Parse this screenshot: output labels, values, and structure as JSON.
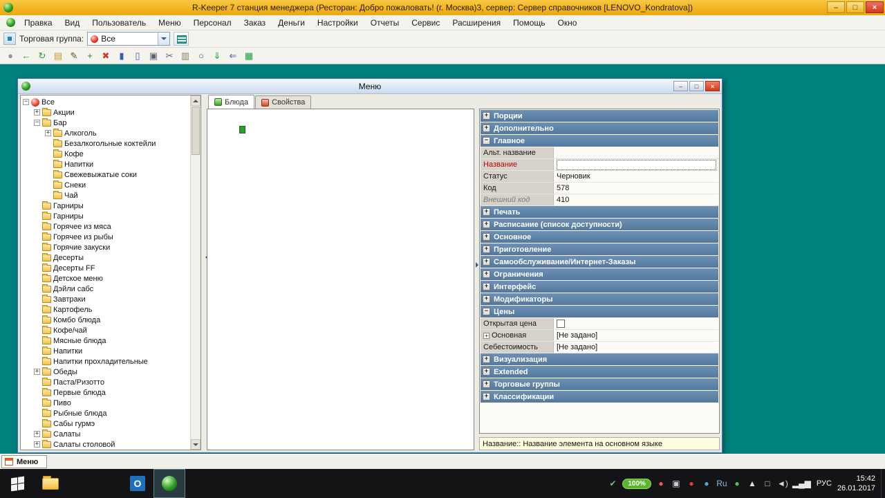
{
  "colors": {
    "titlebar_orange": "#f2b01c",
    "desktop_teal": "#00807e",
    "section_header_blue": "#5d81a6",
    "hint_yellow": "#ffffe0",
    "required_label_red": "#c00000",
    "battery_green": "#5cb52c"
  },
  "app": {
    "title": "R-Keeper 7 станция менеджера (Ресторан: Добро пожаловать! (г. Москва)3, сервер: Сервер справочников [LENOVO_Kondratova])"
  },
  "window_controls": {
    "minimize": "–",
    "maximize": "□",
    "close": "×"
  },
  "menubar": {
    "items": [
      "Правка",
      "Вид",
      "Пользователь",
      "Меню",
      "Персонал",
      "Заказ",
      "Деньги",
      "Настройки",
      "Отчеты",
      "Сервис",
      "Расширения",
      "Помощь",
      "Окно"
    ]
  },
  "trade_toolbar": {
    "label": "Торговая группа:",
    "value": "Все"
  },
  "toolbar_icons": [
    {
      "name": "properties-icon",
      "glyph": "●",
      "color": "#8f97a0"
    },
    {
      "name": "back-icon",
      "glyph": "←",
      "color": "#1f9e40"
    },
    {
      "name": "refresh-icon",
      "glyph": "↻",
      "color": "#1f9e40"
    },
    {
      "name": "open-folder-icon",
      "glyph": "▤",
      "color": "#c79b23"
    },
    {
      "name": "edit-icon",
      "glyph": "✎",
      "color": "#6b4f1d"
    },
    {
      "name": "new-item-icon",
      "glyph": "+",
      "color": "#2d7d2d"
    },
    {
      "name": "delete-icon",
      "glyph": "✖",
      "color": "#cf3a22"
    },
    {
      "name": "save-icon",
      "glyph": "▮",
      "color": "#3a5fa8"
    },
    {
      "name": "save-all-icon",
      "glyph": "▯",
      "color": "#3a5fa8"
    },
    {
      "name": "copy-icon",
      "glyph": "▣",
      "color": "#5b6770"
    },
    {
      "name": "cut-icon",
      "glyph": "✂",
      "color": "#5b6770"
    },
    {
      "name": "paste-icon",
      "glyph": "▥",
      "color": "#8a7d5b"
    },
    {
      "name": "search-icon",
      "glyph": "○",
      "color": "#2d5d8d"
    },
    {
      "name": "export-icon",
      "glyph": "⇓",
      "color": "#1f9e40"
    },
    {
      "name": "import-icon",
      "glyph": "⇐",
      "color": "#3a5fa8"
    },
    {
      "name": "table-view-icon",
      "glyph": "▦",
      "color": "#1f9e40"
    }
  ],
  "menu_window": {
    "title": "Меню",
    "tabs": [
      {
        "id": "dishes",
        "label": "Блюда",
        "active": true,
        "icon": "dishes-tab-icon"
      },
      {
        "id": "properties",
        "label": "Свойства",
        "active": false,
        "icon": "properties-tab-icon"
      }
    ],
    "tree": [
      {
        "label": "Все",
        "depth": 0,
        "expander": "minus",
        "icon": "root"
      },
      {
        "label": "Акции",
        "depth": 1,
        "expander": "plus",
        "icon": "folder"
      },
      {
        "label": "Бар",
        "depth": 1,
        "expander": "minus",
        "icon": "folder"
      },
      {
        "label": "Алкоголь",
        "depth": 2,
        "expander": "plus",
        "icon": "folder"
      },
      {
        "label": "Безалкогольные коктейли",
        "depth": 2,
        "expander": "none",
        "icon": "folder"
      },
      {
        "label": "Кофе",
        "depth": 2,
        "expander": "none",
        "icon": "folder"
      },
      {
        "label": "Напитки",
        "depth": 2,
        "expander": "none",
        "icon": "folder"
      },
      {
        "label": "Свежевыжатые соки",
        "depth": 2,
        "expander": "none",
        "icon": "folder"
      },
      {
        "label": "Снеки",
        "depth": 2,
        "expander": "none",
        "icon": "folder"
      },
      {
        "label": "Чай",
        "depth": 2,
        "expander": "none",
        "icon": "folder"
      },
      {
        "label": "Гарниры",
        "depth": 1,
        "expander": "none",
        "icon": "folder"
      },
      {
        "label": "Гарниры",
        "depth": 1,
        "expander": "none",
        "icon": "folder"
      },
      {
        "label": "Горячее из мяса",
        "depth": 1,
        "expander": "none",
        "icon": "folder"
      },
      {
        "label": "Горячее из рыбы",
        "depth": 1,
        "expander": "none",
        "icon": "folder"
      },
      {
        "label": "Горячие закуски",
        "depth": 1,
        "expander": "none",
        "icon": "folder"
      },
      {
        "label": "Десерты",
        "depth": 1,
        "expander": "none",
        "icon": "folder"
      },
      {
        "label": "Десерты FF",
        "depth": 1,
        "expander": "none",
        "icon": "folder"
      },
      {
        "label": "Детское меню",
        "depth": 1,
        "expander": "none",
        "icon": "folder"
      },
      {
        "label": "Дэйли сабс",
        "depth": 1,
        "expander": "none",
        "icon": "folder"
      },
      {
        "label": "Завтраки",
        "depth": 1,
        "expander": "none",
        "icon": "folder"
      },
      {
        "label": "Картофель",
        "depth": 1,
        "expander": "none",
        "icon": "folder"
      },
      {
        "label": "Комбо блюда",
        "depth": 1,
        "expander": "none",
        "icon": "folder"
      },
      {
        "label": "Кофе/чай",
        "depth": 1,
        "expander": "none",
        "icon": "folder"
      },
      {
        "label": "Мясные блюда",
        "depth": 1,
        "expander": "none",
        "icon": "folder"
      },
      {
        "label": "Напитки",
        "depth": 1,
        "expander": "none",
        "icon": "folder"
      },
      {
        "label": "Напитки прохладительные",
        "depth": 1,
        "expander": "none",
        "icon": "folder"
      },
      {
        "label": "Обеды",
        "depth": 1,
        "expander": "plus",
        "icon": "folder"
      },
      {
        "label": "Паста/Ризотто",
        "depth": 1,
        "expander": "none",
        "icon": "folder"
      },
      {
        "label": "Первые блюда",
        "depth": 1,
        "expander": "none",
        "icon": "folder"
      },
      {
        "label": "Пиво",
        "depth": 1,
        "expander": "none",
        "icon": "folder"
      },
      {
        "label": "Рыбные блюда",
        "depth": 1,
        "expander": "none",
        "icon": "folder"
      },
      {
        "label": "Сабы гурмэ",
        "depth": 1,
        "expander": "none",
        "icon": "folder"
      },
      {
        "label": "Салаты",
        "depth": 1,
        "expander": "plus",
        "icon": "folder"
      },
      {
        "label": "Салаты столовой",
        "depth": 1,
        "expander": "plus",
        "icon": "folder"
      }
    ],
    "sections": [
      {
        "label": "Порции",
        "expanded": false
      },
      {
        "label": "Дополнительно",
        "expanded": false
      },
      {
        "label": "Главное",
        "expanded": true,
        "rows": [
          {
            "label": "Альт. название",
            "value": "",
            "kind": "text"
          },
          {
            "label": "Название",
            "value": "",
            "kind": "input",
            "label_style": "red"
          },
          {
            "label": "Статус",
            "value": "Черновик",
            "kind": "text"
          },
          {
            "label": "Код",
            "value": "578",
            "kind": "text"
          },
          {
            "label": "Внешний код",
            "value": "410",
            "kind": "text",
            "label_style": "italic"
          }
        ]
      },
      {
        "label": "Печать",
        "expanded": false
      },
      {
        "label": "Расписание (список доступности)",
        "expanded": false
      },
      {
        "label": "Основное",
        "expanded": false
      },
      {
        "label": "Приготовление",
        "expanded": false
      },
      {
        "label": "Самообслуживание/Интернет-Заказы",
        "expanded": false
      },
      {
        "label": "Ограничения",
        "expanded": false
      },
      {
        "label": "Интерфейс",
        "expanded": false
      },
      {
        "label": "Модификаторы",
        "expanded": false
      },
      {
        "label": "Цены",
        "expanded": true,
        "rows": [
          {
            "label": "Открытая цена",
            "value": "",
            "kind": "checkbox"
          },
          {
            "label": "Основная",
            "value": "[Не задано]",
            "kind": "text",
            "expander": true
          },
          {
            "label": "Себестоимость",
            "value": "[Не задано]",
            "kind": "text"
          }
        ]
      },
      {
        "label": "Визуализация",
        "expanded": false
      },
      {
        "label": "Extended",
        "expanded": false
      },
      {
        "label": "Торговые группы",
        "expanded": false
      },
      {
        "label": "Классификации",
        "expanded": false
      }
    ],
    "hint": "Название:: Название элемента на основном языке"
  },
  "mdi_bar": {
    "label": "Меню"
  },
  "taskbar": {
    "lang": "РУС",
    "time": "15:42",
    "date": "26.01.2017",
    "app_icons": [
      {
        "name": "file-explorer-icon",
        "kind": "folder"
      },
      {
        "kind": "gap",
        "width": 80
      },
      {
        "name": "outlook-icon",
        "kind": "glyph",
        "glyph": "O",
        "bg": "#1e71b8"
      },
      {
        "name": "rkeeper-taskbar-icon",
        "kind": "sphere",
        "active": true
      }
    ],
    "tray_icons": [
      {
        "name": "antivirus-shield-icon",
        "glyph": "✔",
        "color": "#6bc76b"
      },
      {
        "name": "battery-indicator",
        "kind": "pill",
        "label": "100%"
      },
      {
        "name": "opera-icon",
        "glyph": "●",
        "color": "#f35b3f"
      },
      {
        "name": "camera-icon",
        "glyph": "▣",
        "color": "#c9ced4"
      },
      {
        "name": "rkeeper-agent-icon",
        "glyph": "●",
        "color": "#e04232"
      },
      {
        "name": "messenger-icon",
        "glyph": "●",
        "color": "#4aa8dd"
      },
      {
        "name": "punto-switcher-icon",
        "glyph": "Ru",
        "color": "#86b8ea"
      },
      {
        "name": "sync-status-icon",
        "glyph": "●",
        "color": "#54bd58"
      },
      {
        "name": "hidden-icons-chevron",
        "glyph": "▲",
        "color": "#e0e0e0"
      },
      {
        "name": "display-icon",
        "glyph": "□",
        "color": "#d8d8d8"
      },
      {
        "name": "volume-icon",
        "glyph": "◄)",
        "color": "#d8d8d8"
      },
      {
        "name": "network-icon",
        "glyph": "▂▄▆",
        "color": "#e8e8e8"
      }
    ]
  }
}
